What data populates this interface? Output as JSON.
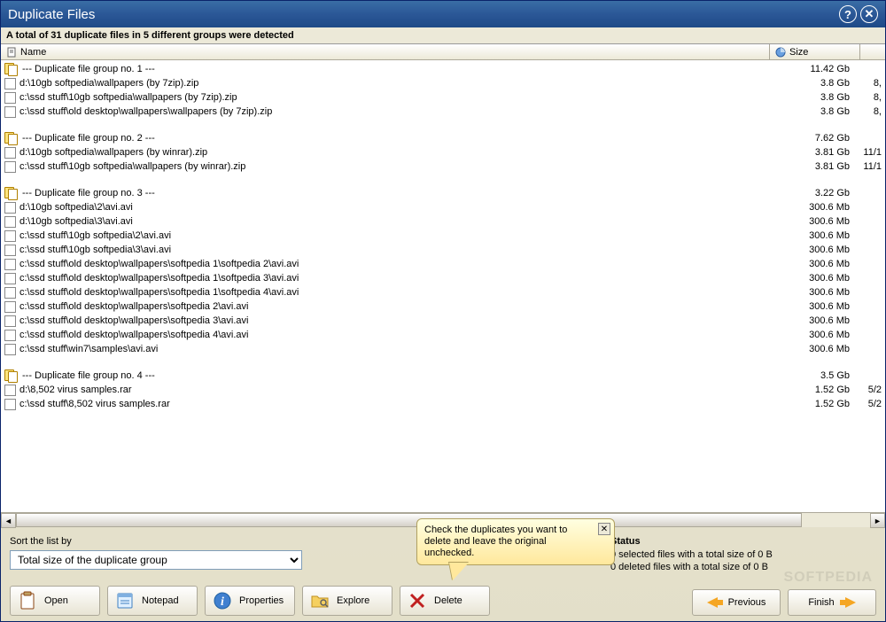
{
  "titlebar": {
    "title": "Duplicate Files"
  },
  "summary": "A total of 31 duplicate files in 5 different groups were detected",
  "columns": {
    "name": "Name",
    "size": "Size"
  },
  "rows": [
    {
      "type": "group",
      "label": "  --- Duplicate file group no. 1 ---",
      "size": "11.42 Gb",
      "extra": ""
    },
    {
      "type": "file",
      "label": "d:\\10gb softpedia\\wallpapers (by 7zip).zip",
      "size": "3.8 Gb",
      "extra": "8,"
    },
    {
      "type": "file",
      "label": "c:\\ssd stuff\\10gb softpedia\\wallpapers (by 7zip).zip",
      "size": "3.8 Gb",
      "extra": "8,"
    },
    {
      "type": "file",
      "label": "c:\\ssd stuff\\old desktop\\wallpapers\\wallpapers (by 7zip).zip",
      "size": "3.8 Gb",
      "extra": "8,"
    },
    {
      "type": "blank"
    },
    {
      "type": "group",
      "label": "  --- Duplicate file group no. 2 ---",
      "size": "7.62 Gb",
      "extra": ""
    },
    {
      "type": "file",
      "label": "d:\\10gb softpedia\\wallpapers (by winrar).zip",
      "size": "3.81 Gb",
      "extra": "11/1"
    },
    {
      "type": "file",
      "label": "c:\\ssd stuff\\10gb softpedia\\wallpapers (by winrar).zip",
      "size": "3.81 Gb",
      "extra": "11/1"
    },
    {
      "type": "blank"
    },
    {
      "type": "group",
      "label": "  --- Duplicate file group no. 3 ---",
      "size": "3.22 Gb",
      "extra": ""
    },
    {
      "type": "file",
      "label": "d:\\10gb softpedia\\2\\avi.avi",
      "size": "300.6 Mb",
      "extra": ""
    },
    {
      "type": "file",
      "label": "d:\\10gb softpedia\\3\\avi.avi",
      "size": "300.6 Mb",
      "extra": ""
    },
    {
      "type": "file",
      "label": "c:\\ssd stuff\\10gb softpedia\\2\\avi.avi",
      "size": "300.6 Mb",
      "extra": ""
    },
    {
      "type": "file",
      "label": "c:\\ssd stuff\\10gb softpedia\\3\\avi.avi",
      "size": "300.6 Mb",
      "extra": ""
    },
    {
      "type": "file",
      "label": "c:\\ssd stuff\\old desktop\\wallpapers\\softpedia 1\\softpedia 2\\avi.avi",
      "size": "300.6 Mb",
      "extra": ""
    },
    {
      "type": "file",
      "label": "c:\\ssd stuff\\old desktop\\wallpapers\\softpedia 1\\softpedia 3\\avi.avi",
      "size": "300.6 Mb",
      "extra": ""
    },
    {
      "type": "file",
      "label": "c:\\ssd stuff\\old desktop\\wallpapers\\softpedia 1\\softpedia 4\\avi.avi",
      "size": "300.6 Mb",
      "extra": ""
    },
    {
      "type": "file",
      "label": "c:\\ssd stuff\\old desktop\\wallpapers\\softpedia 2\\avi.avi",
      "size": "300.6 Mb",
      "extra": ""
    },
    {
      "type": "file",
      "label": "c:\\ssd stuff\\old desktop\\wallpapers\\softpedia 3\\avi.avi",
      "size": "300.6 Mb",
      "extra": ""
    },
    {
      "type": "file",
      "label": "c:\\ssd stuff\\old desktop\\wallpapers\\softpedia 4\\avi.avi",
      "size": "300.6 Mb",
      "extra": ""
    },
    {
      "type": "file",
      "label": "c:\\ssd stuff\\win7\\samples\\avi.avi",
      "size": "300.6 Mb",
      "extra": ""
    },
    {
      "type": "blank"
    },
    {
      "type": "group",
      "label": "  --- Duplicate file group no. 4 ---",
      "size": "3.5 Gb",
      "extra": ""
    },
    {
      "type": "file",
      "label": "d:\\8,502 virus samples.rar",
      "size": "1.52 Gb",
      "extra": "5/2"
    },
    {
      "type": "file",
      "label": "c:\\ssd stuff\\8,502 virus samples.rar",
      "size": "1.52 Gb",
      "extra": "5/2"
    }
  ],
  "sort": {
    "label": "Sort the list by",
    "value": "Total size of the duplicate group"
  },
  "tooltip": {
    "text": "Check the duplicates you want to delete and leave the original unchecked."
  },
  "status": {
    "title": "Status",
    "line1": "0 selected files with a total size of 0 B",
    "line2": "0 deleted files with a total size of 0 B"
  },
  "buttons": {
    "open": "Open",
    "notepad": "Notepad",
    "properties": "Properties",
    "explore": "Explore",
    "delete": "Delete",
    "previous": "Previous",
    "finish": "Finish"
  },
  "watermark": "SOFTPEDIA"
}
